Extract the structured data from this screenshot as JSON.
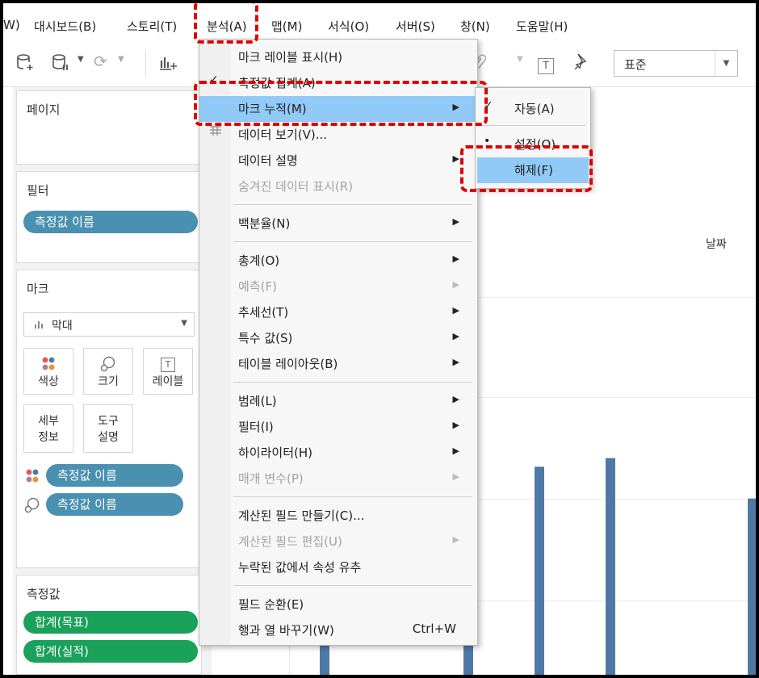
{
  "menubar": {
    "items": [
      {
        "label": "W)"
      },
      {
        "label": "대시보드(B)"
      },
      {
        "label": "스토리(T)"
      },
      {
        "label": "분석(A)"
      },
      {
        "label": "맵(M)"
      },
      {
        "label": "서식(O)"
      },
      {
        "label": "서버(S)"
      },
      {
        "label": "창(N)"
      },
      {
        "label": "도움말(H)"
      }
    ]
  },
  "toolbar": {
    "format_value": "표준",
    "label_icon_text": "T"
  },
  "left_panel": {
    "pages_title": "페이지",
    "filters_title": "필터",
    "filter_pill": "측정값 이름",
    "marks_title": "마크",
    "mark_type": "막대",
    "mark_buttons": {
      "color": "색상",
      "size": "크기",
      "label": "레이블",
      "label_icon_text": "T",
      "detail_line1": "세부",
      "detail_line2": "정보",
      "tooltip_line1": "도구",
      "tooltip_line2": "설명"
    },
    "mark_pills": [
      "측정값 이름",
      "측정값 이름"
    ],
    "measures_title": "측정값",
    "measure_pills": [
      "합계(목표)",
      "합계(실적)"
    ]
  },
  "canvas": {
    "axis_title": "날짜"
  },
  "analysis_menu": {
    "items": [
      {
        "label": "마크 레이블 표시(H)",
        "check": "",
        "arrow": false,
        "disabled": false
      },
      {
        "label": "측정값 집계(A)",
        "check": "✓",
        "arrow": false,
        "disabled": false
      },
      {
        "label": "마크 누적(M)",
        "check": "",
        "arrow": true,
        "disabled": false,
        "highlighted": true
      },
      {
        "label": "데이터 보기(V)...",
        "check": "",
        "arrow": false,
        "disabled": false
      },
      {
        "label": "데이터 설명",
        "check": "",
        "arrow": true,
        "disabled": false
      },
      {
        "label": "숨겨진 데이터 표시(R)",
        "check": "",
        "arrow": false,
        "disabled": true
      },
      {
        "label": "백분율(N)",
        "check": "",
        "arrow": true,
        "disabled": false
      },
      {
        "label": "총계(O)",
        "check": "",
        "arrow": true,
        "disabled": false
      },
      {
        "label": "예측(F)",
        "check": "",
        "arrow": true,
        "disabled": true
      },
      {
        "label": "추세선(T)",
        "check": "",
        "arrow": true,
        "disabled": false
      },
      {
        "label": "특수 값(S)",
        "check": "",
        "arrow": true,
        "disabled": false
      },
      {
        "label": "테이블 레이아웃(B)",
        "check": "",
        "arrow": true,
        "disabled": false
      },
      {
        "label": "범례(L)",
        "check": "",
        "arrow": true,
        "disabled": false
      },
      {
        "label": "필터(I)",
        "check": "",
        "arrow": true,
        "disabled": false
      },
      {
        "label": "하이라이터(H)",
        "check": "",
        "arrow": true,
        "disabled": false
      },
      {
        "label": "매개 변수(P)",
        "check": "",
        "arrow": true,
        "disabled": true
      },
      {
        "label": "계산된 필드 만들기(C)...",
        "check": "",
        "arrow": false,
        "disabled": false
      },
      {
        "label": "계산된 필드 편집(U)",
        "check": "",
        "arrow": true,
        "disabled": true
      },
      {
        "label": "누락된 값에서 속성 유추",
        "check": "",
        "arrow": false,
        "disabled": false
      },
      {
        "label": "필드 순환(E)",
        "check": "",
        "arrow": false,
        "disabled": false
      },
      {
        "label": "행과 열 바꾸기(W)",
        "check": "",
        "arrow": false,
        "disabled": false,
        "shortcut": "Ctrl+W"
      }
    ]
  },
  "stack_submenu": {
    "items": [
      {
        "label": "자동(A)",
        "mark": "✓"
      },
      {
        "label": "설정(O)",
        "mark": "•"
      },
      {
        "label": "해제(F)",
        "mark": "",
        "highlighted": true
      }
    ]
  },
  "colors": {
    "menu_highlight": "#91c9f7",
    "annotation_red": "#e00000",
    "bar_color": "#4e79a7",
    "pill_blue": "#4a90b0",
    "pill_green": "#1aa15a"
  },
  "chart_data": {
    "type": "bar",
    "note_values": "relative bar heights visible below the menu (0-1 of visible plot height)",
    "values": [
      0.33,
      0.19,
      0.72,
      0.75,
      0.61
    ]
  }
}
